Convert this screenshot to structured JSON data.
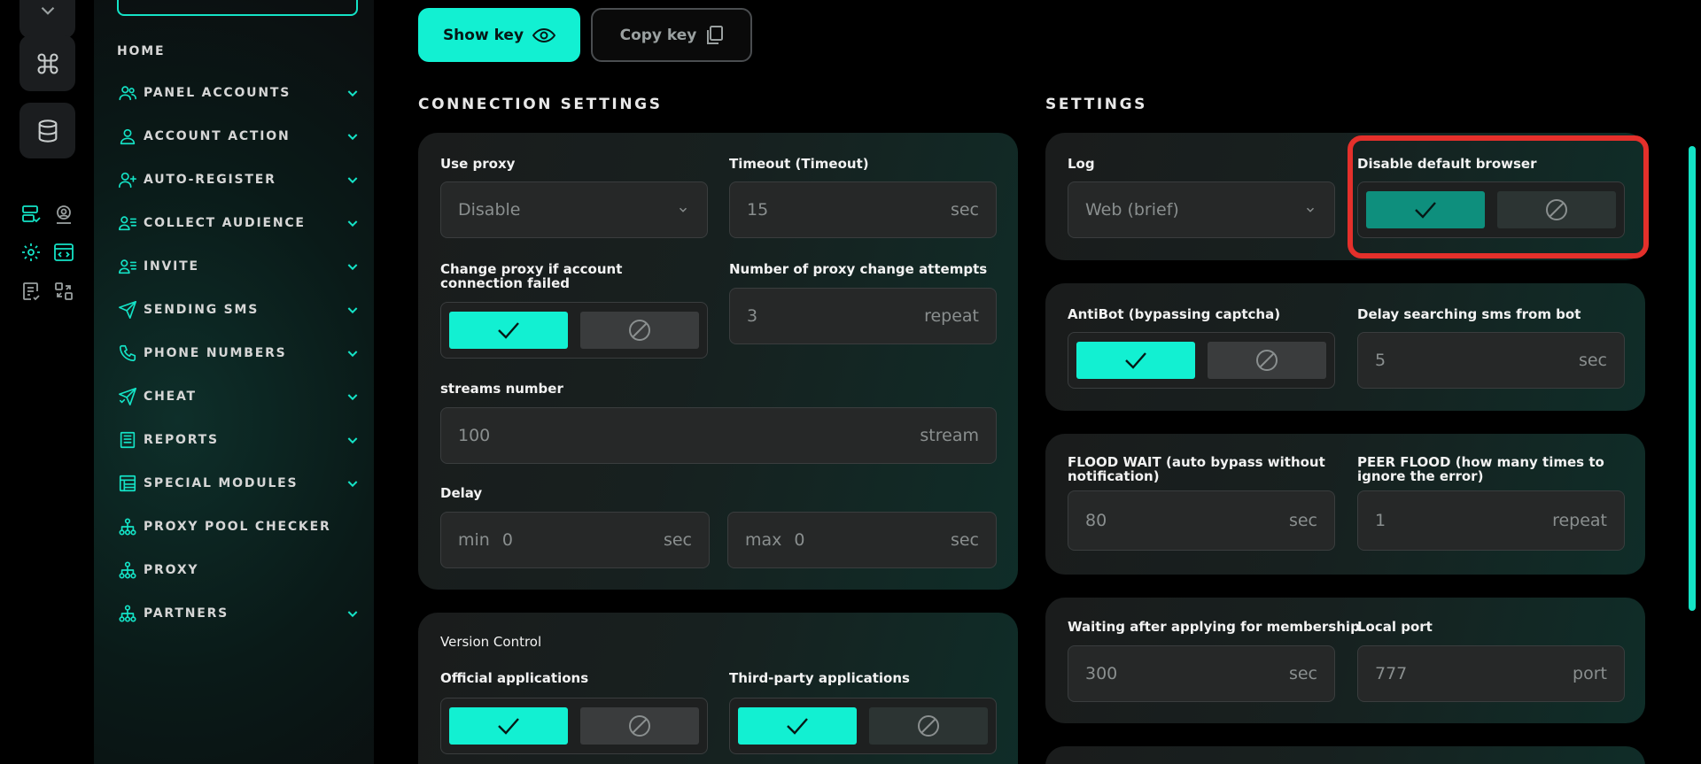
{
  "colors": {
    "accent": "#12f0d2",
    "highlight": "#e4302b",
    "background": "#000000"
  },
  "rail": {
    "icons": [
      "chevron-down-icon",
      "command-icon",
      "database-icon",
      "server-check-icon",
      "user-pin-icon",
      "settings-icon",
      "code-window-icon",
      "report-check-icon",
      "shuffle-icon"
    ]
  },
  "sidebar": {
    "home": "HOME",
    "items": [
      {
        "label": "PANEL ACCOUNTS",
        "icon": "users-icon",
        "expandable": true
      },
      {
        "label": "ACCOUNT ACTION",
        "icon": "user-icon",
        "expandable": true
      },
      {
        "label": "AUTO-REGISTER",
        "icon": "user-plus-icon",
        "expandable": true
      },
      {
        "label": "COLLECT AUDIENCE",
        "icon": "user-list-icon",
        "expandable": true
      },
      {
        "label": "INVITE",
        "icon": "user-list-icon",
        "expandable": true
      },
      {
        "label": "SENDING SMS",
        "icon": "send-icon",
        "expandable": true
      },
      {
        "label": "PHONE NUMBERS",
        "icon": "phone-icon",
        "expandable": true
      },
      {
        "label": "CHEAT",
        "icon": "send-check-icon",
        "expandable": true
      },
      {
        "label": "REPORTS",
        "icon": "report-icon",
        "expandable": true
      },
      {
        "label": "SPECIAL MODULES",
        "icon": "modules-icon",
        "expandable": true
      },
      {
        "label": "PROXY POOL CHECKER",
        "icon": "network-icon",
        "expandable": false
      },
      {
        "label": "PROXY",
        "icon": "network-icon",
        "expandable": false
      },
      {
        "label": "PARTNERS",
        "icon": "network-icon",
        "expandable": true
      }
    ]
  },
  "top_buttons": {
    "show_key": "Show key",
    "copy_key": "Copy key"
  },
  "connection": {
    "title": "CONNECTION SETTINGS",
    "use_proxy": {
      "label": "Use proxy",
      "value": "Disable"
    },
    "timeout": {
      "label": "Timeout (Timeout)",
      "value": "15",
      "unit": "sec"
    },
    "change_proxy": {
      "label": "Change proxy if account connection failed",
      "enabled": true
    },
    "proxy_attempts": {
      "label": "Number of proxy change attempts",
      "value": "3",
      "unit": "repeat"
    },
    "streams": {
      "label": "streams number",
      "value": "100",
      "unit": "stream"
    },
    "delay": {
      "label": "Delay",
      "min_prefix": "min",
      "min_value": "0",
      "max_prefix": "max",
      "max_value": "0",
      "unit": "sec"
    }
  },
  "version": {
    "title": "Version Control",
    "official": {
      "label": "Official applications",
      "enabled": true
    },
    "third_party": {
      "label": "Third-party applications",
      "enabled": true
    }
  },
  "settings": {
    "title": "SETTINGS",
    "log": {
      "label": "Log",
      "value": "Web (brief)"
    },
    "disable_browser": {
      "label": "Disable default browser",
      "enabled": true
    },
    "antibot": {
      "label": "AntiBot (bypassing captcha)",
      "enabled": true
    },
    "delay_sms": {
      "label": "Delay searching sms from bot",
      "value": "5",
      "unit": "sec"
    },
    "flood_wait": {
      "label": "FLOOD WAIT (auto bypass without notification)",
      "value": "80",
      "unit": "sec"
    },
    "peer_flood": {
      "label": "PEER FLOOD (how many times to ignore the error)",
      "value": "1",
      "unit": "repeat"
    },
    "waiting_membership": {
      "label": "Waiting after applying for membership",
      "value": "300",
      "unit": "sec"
    },
    "local_port": {
      "label": "Local port",
      "value": "777",
      "unit": "port"
    }
  }
}
